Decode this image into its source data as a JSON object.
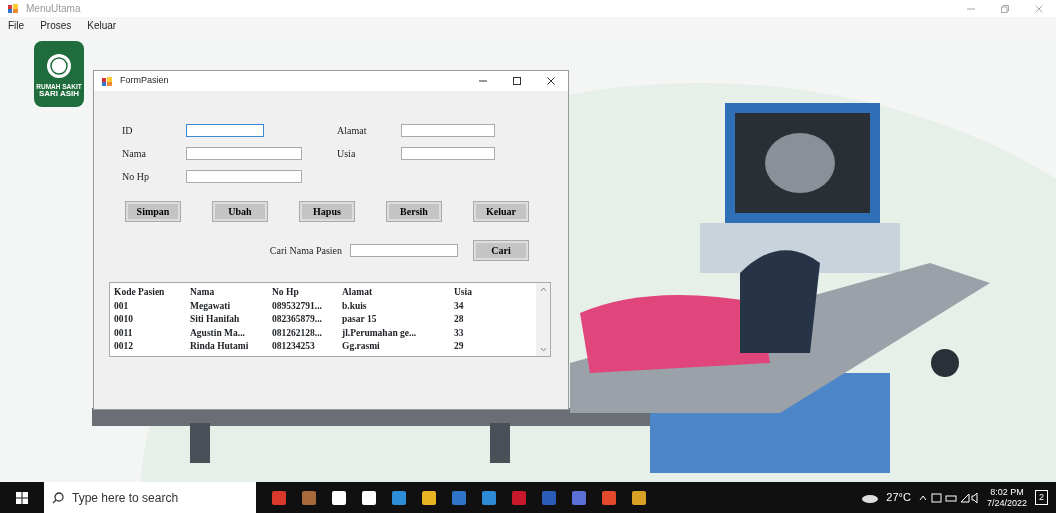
{
  "window": {
    "title": "MenuUtama"
  },
  "menu": [
    "File",
    "Proses",
    "Keluar"
  ],
  "logo": {
    "line_1": "RUMAH SAKIT",
    "line_2": "SARI ASIH"
  },
  "form": {
    "title": "FormPasien",
    "fields": [
      {
        "label": "ID",
        "focused": true
      },
      {
        "label": "Alamat",
        "focused": false
      },
      {
        "label": "Nama",
        "focused": false
      },
      {
        "label": "Usia",
        "focused": false
      },
      {
        "label": "No Hp",
        "focused": false
      }
    ],
    "buttons": [
      "Simpan",
      "Ubah",
      "Hapus",
      "Bersih",
      "Keluar"
    ],
    "search": {
      "label": "Cari Nama Pasien",
      "button": "Cari"
    },
    "table": {
      "columns": [
        "Kode Pasien",
        "Nama",
        "No Hp",
        "Alamat",
        "Usia"
      ],
      "rows": [
        [
          "001",
          "Megawati",
          "089532791...",
          "b.kuis",
          "34"
        ],
        [
          "0010",
          "Siti Hanifah",
          "082365879...",
          "pasar 15",
          "28"
        ],
        [
          "0011",
          "Agustin Ma...",
          "081262128...",
          "jl.Perumahan ge...",
          "33"
        ],
        [
          "0012",
          "Rinda Hutami",
          "081234253",
          "Gg.rasmi",
          "29"
        ]
      ]
    }
  },
  "taskbar": {
    "search_placeholder": "Type here to search",
    "temperature": "27°C",
    "time": "8:02 PM",
    "date": "7/24/2022",
    "notification_count": "2"
  }
}
